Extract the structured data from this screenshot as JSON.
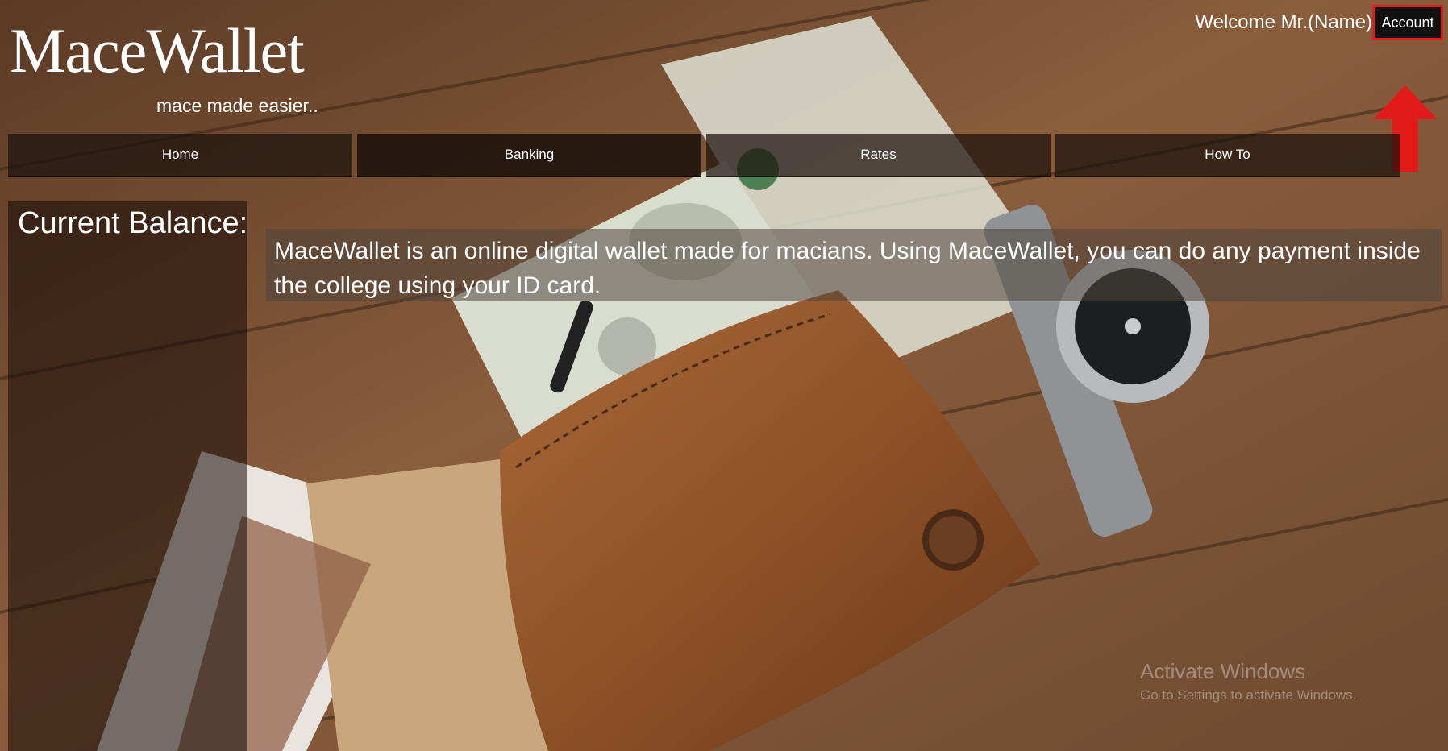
{
  "brand": {
    "name": "MaceWallet",
    "tagline": "mace made easier.."
  },
  "header": {
    "welcome": "Welcome Mr.(Name)",
    "account_label": "Account"
  },
  "nav": [
    {
      "label": "Home"
    },
    {
      "label": "Banking"
    },
    {
      "label": "Rates"
    },
    {
      "label": "How To"
    }
  ],
  "balance": {
    "title": "Current Balance:"
  },
  "intro": {
    "text": "MaceWallet is an online digital wallet made for macians. Using MaceWallet, you can do any payment inside the college using your ID card."
  },
  "watermark": {
    "title": "Activate Windows",
    "subtitle": "Go to Settings to activate Windows."
  },
  "colors": {
    "highlight": "#e31a1a",
    "nav_bg": "#1c120c",
    "wood": "#7a5236"
  },
  "icons": {
    "annotation": "red-up-arrow-icon"
  }
}
